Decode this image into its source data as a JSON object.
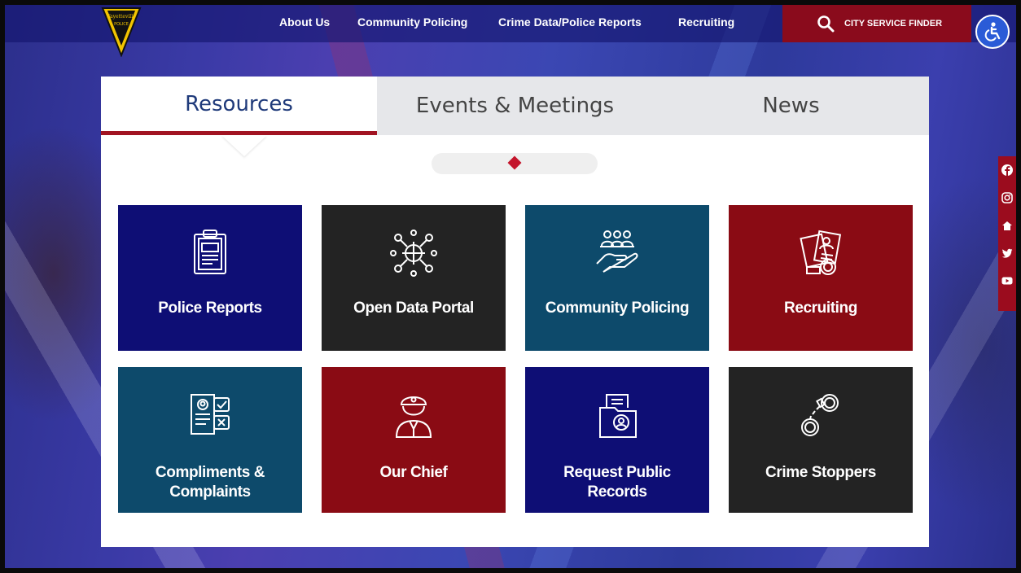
{
  "nav": {
    "links": [
      "About Us",
      "Community Policing",
      "Crime Data/Police Reports",
      "Recruiting"
    ],
    "finder_label": "CITY SERVICE FINDER"
  },
  "logo": {
    "line1": "Fayetteville",
    "line2": "POLICE"
  },
  "tabs": [
    {
      "label": "Resources",
      "active": true
    },
    {
      "label": "Events & Meetings",
      "active": false
    },
    {
      "label": "News",
      "active": false
    }
  ],
  "tiles": [
    {
      "label": "Police Reports",
      "color": "#0e0e75",
      "icon": "clipboard-report-icon"
    },
    {
      "label": "Open Data Portal",
      "color": "#232323",
      "icon": "network-target-icon"
    },
    {
      "label": "Community Policing",
      "color": "#0d4a6b",
      "icon": "community-hand-icon"
    },
    {
      "label": "Recruiting",
      "color": "#8a0b14",
      "icon": "id-badge-icon"
    },
    {
      "label": "Compliments & Complaints",
      "color": "#0d4a6b",
      "icon": "feedback-form-icon"
    },
    {
      "label": "Our Chief",
      "color": "#8a0b14",
      "icon": "officer-icon"
    },
    {
      "label": "Request Public Records",
      "color": "#0e0e75",
      "icon": "records-folder-icon"
    },
    {
      "label": "Crime Stoppers",
      "color": "#232323",
      "icon": "handcuffs-icon"
    }
  ],
  "social": [
    "facebook-icon",
    "instagram-icon",
    "nextdoor-icon",
    "twitter-icon",
    "youtube-icon"
  ],
  "colors": {
    "accent": "#a11322",
    "finder_bg": "#8a0b1c",
    "a11y_bg": "#2a5bd7"
  }
}
